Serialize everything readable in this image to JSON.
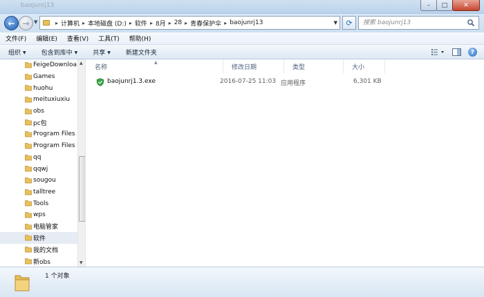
{
  "window": {
    "title": "baojunrj13"
  },
  "address_bar": {
    "crumbs": [
      "计算机",
      "本地磁盘 (D:)",
      "软件",
      "8月",
      "28",
      "青春保护伞",
      "baojunrj13"
    ]
  },
  "search": {
    "placeholder": "搜索 baojunrj13"
  },
  "menu": {
    "items": [
      "文件(F)",
      "编辑(E)",
      "查看(V)",
      "工具(T)",
      "帮助(H)"
    ]
  },
  "toolbar": {
    "organize": "组织",
    "include_in_library": "包含到库中",
    "share": "共享",
    "new_folder": "新建文件夹"
  },
  "nav": {
    "items": [
      {
        "label": "FeigeDownloa"
      },
      {
        "label": "Games"
      },
      {
        "label": "huohu"
      },
      {
        "label": "meituxiuxiu"
      },
      {
        "label": "obs"
      },
      {
        "label": "pc包"
      },
      {
        "label": "Program Files"
      },
      {
        "label": "Program Files"
      },
      {
        "label": "qq"
      },
      {
        "label": "qqwj"
      },
      {
        "label": "sougou"
      },
      {
        "label": "talltree"
      },
      {
        "label": "Tools"
      },
      {
        "label": "wps"
      },
      {
        "label": "电脑管家"
      },
      {
        "label": "软件"
      },
      {
        "label": "我的文档"
      },
      {
        "label": "新obs"
      }
    ],
    "selected_label": "软件"
  },
  "columns": {
    "name": "名称",
    "modified": "修改日期",
    "type": "类型",
    "size": "大小"
  },
  "files": [
    {
      "name": "baojunrj1.3.exe",
      "modified": "2016-07-25 11:03",
      "type": "应用程序",
      "size": "6,301 KB"
    }
  ],
  "details": {
    "count": "1 个对象"
  },
  "colors": {
    "accent": "#2460b4",
    "folder": "#e8c15a",
    "selection": "#e6ecf3"
  }
}
